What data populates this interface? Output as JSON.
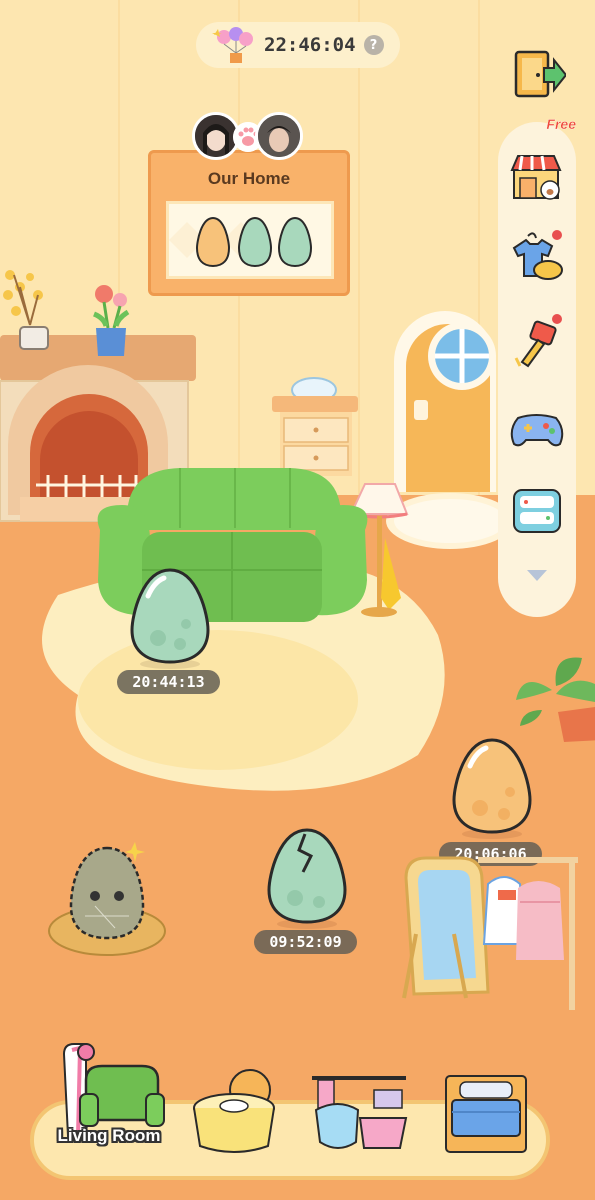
{
  "header": {
    "countdown": "22:46:04",
    "help_icon": "question-mark-icon"
  },
  "home_frame": {
    "title": "Our Home",
    "eggs": [
      "orange-egg",
      "green-egg",
      "green-egg"
    ]
  },
  "sidebar": {
    "items": [
      {
        "name": "shop",
        "icon": "shop-icon",
        "badge": "Free"
      },
      {
        "name": "wardrobe",
        "icon": "clothes-icon",
        "notification": true
      },
      {
        "name": "decorate",
        "icon": "paint-brush-icon",
        "notification": true
      },
      {
        "name": "games",
        "icon": "gamepad-icon",
        "notification": false
      },
      {
        "name": "chat",
        "icon": "chat-icon",
        "notification": false
      }
    ],
    "more_icon": "chevron-down-icon"
  },
  "floor_eggs": [
    {
      "timer": "20:44:13",
      "color": "#a8d8bc"
    },
    {
      "timer": "09:52:09",
      "color": "#a8d8bc"
    },
    {
      "timer": "20:06:06",
      "color": "#f7c27a"
    }
  ],
  "bottom_nav": {
    "tabs": [
      {
        "label": "Living\nRoom",
        "room": "living-room",
        "active": true
      },
      {
        "room": "dining-room",
        "active": false
      },
      {
        "room": "bathroom",
        "active": false
      },
      {
        "room": "bedroom",
        "active": false
      }
    ],
    "living_room_label": "Living Room"
  },
  "colors": {
    "wall": "#fde6b0",
    "floor": "#f5a865",
    "sofa": "#7cc95c",
    "accent": "#f3c572"
  }
}
